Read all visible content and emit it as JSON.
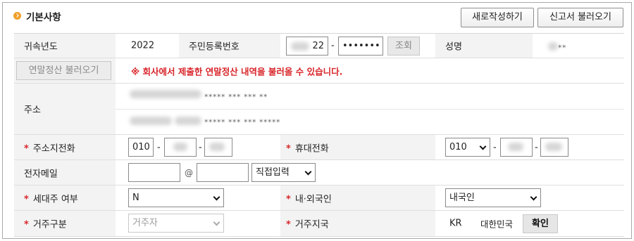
{
  "header": {
    "title": "기본사항",
    "new_button": "새로작성하기",
    "load_button": "신고서 불러오기"
  },
  "row1": {
    "year_label": "귀속년도",
    "year_value": "2022",
    "rrn_label": "주민등록번호",
    "rrn_front_suffix": "22",
    "rrn_dash": "-",
    "rrn_back": "•••••••",
    "lookup_button": "조회",
    "name_label": "성명",
    "name_value": "**"
  },
  "row2": {
    "load_settlement_button": "연말정산 불러오기",
    "notice": "※ 회사에서 제출한 연말정산 내역을 불러올 수 있습니다."
  },
  "address": {
    "label": "주소",
    "line1_masked": "***** *** *** **",
    "line2_masked": "***** *** *** *****"
  },
  "phones": {
    "home_label": "주소지전화",
    "home_prefix": "010",
    "sep": "-",
    "mobile_label": "휴대전화",
    "mobile_prefix": "010"
  },
  "email": {
    "label": "전자메일",
    "at": "@",
    "domain_select": "직접입력"
  },
  "household": {
    "head_label": "세대주 여부",
    "head_value": "N",
    "nationality_label": "내·외국인",
    "nationality_value": "내국인"
  },
  "residence": {
    "type_label": "거주구분",
    "type_value": "거주자",
    "country_label": "거주지국",
    "country_code": "KR",
    "country_name": "대한민국",
    "confirm_button": "확인"
  },
  "required_mark": "*",
  "colors": {
    "accent_orange": "#f0a02a",
    "required_red": "#d8252a",
    "label_bg": "#f3f3f3"
  }
}
